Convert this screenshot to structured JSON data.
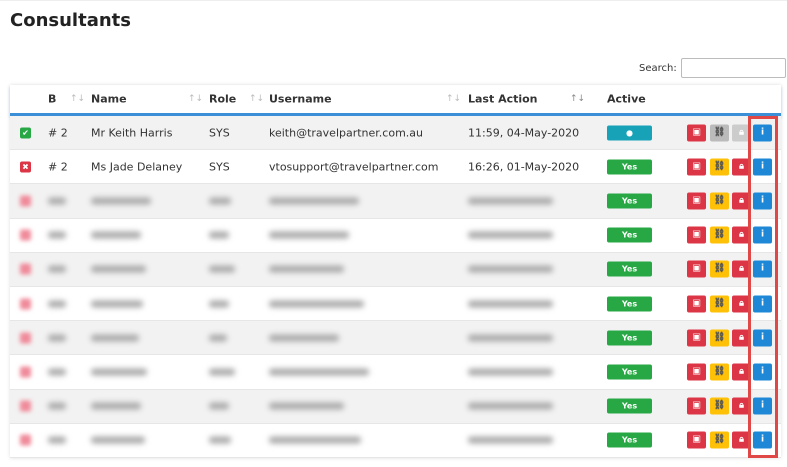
{
  "title": "Consultants",
  "search": {
    "label": "Search:",
    "value": ""
  },
  "columns": {
    "b": "B",
    "name": "Name",
    "role": "Role",
    "username": "Username",
    "last_action": "Last Action",
    "active": "Active"
  },
  "sort_icon": "↑↓",
  "colors": {
    "green": "#28a745",
    "red": "#dc3545",
    "yellow": "#ffc107",
    "blue": "#1e88d6",
    "teal": "#17a2b8",
    "gray": "#bbbbbb",
    "highlight": "#e04848"
  },
  "rows": [
    {
      "status": "check",
      "b": "# 2",
      "name": "Mr Keith Harris",
      "role": "SYS",
      "username": "keith@travelpartner.com.au",
      "last_action": "11:59, 04-May-2020",
      "active": "user-icon",
      "disabled": true
    },
    {
      "status": "cross",
      "b": "# 2",
      "name": "Ms Jade Delaney",
      "role": "SYS",
      "username": "vtosupport@travelpartner.com",
      "last_action": "16:26, 01-May-2020",
      "active": "Yes",
      "disabled": false
    },
    {
      "redacted": true,
      "active": "Yes"
    },
    {
      "redacted": true,
      "active": "Yes"
    },
    {
      "redacted": true,
      "active": "Yes"
    },
    {
      "redacted": true,
      "active": "Yes"
    },
    {
      "redacted": true,
      "active": "Yes"
    },
    {
      "redacted": true,
      "active": "Yes"
    },
    {
      "redacted": true,
      "active": "Yes"
    },
    {
      "redacted": true,
      "active": "Yes"
    }
  ]
}
